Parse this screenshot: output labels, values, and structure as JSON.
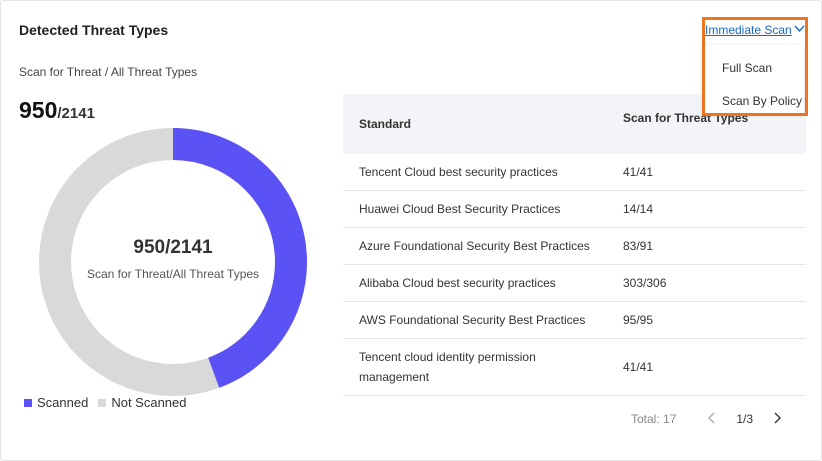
{
  "panel": {
    "title": "Detected Threat Types",
    "subtitle": "Scan for Threat / All Threat Types",
    "summary_main": "950",
    "summary_sub": "/2141"
  },
  "donut": {
    "center_value": "950/2141",
    "center_label": "Scan for Threat/All Threat Types",
    "scanned": 950,
    "total": 2141,
    "scanned_color": "#5b52f6",
    "not_scanned_color": "#d9d9d9"
  },
  "legend": {
    "scanned": "Scanned",
    "not_scanned": "Not Scanned"
  },
  "table": {
    "headers": [
      "Standard",
      "Scan for Threat Types"
    ],
    "rows": [
      {
        "standard": "Tencent Cloud best security practices",
        "value": "41/41"
      },
      {
        "standard": "Huawei Cloud Best Security Practices",
        "value": "14/14"
      },
      {
        "standard": "Azure Foundational Security Best Practices",
        "value": "83/91"
      },
      {
        "standard": "Alibaba Cloud best security practices",
        "value": "303/306"
      },
      {
        "standard": "AWS Foundational Security Best Practices",
        "value": "95/95"
      },
      {
        "standard": "Tencent cloud identity permission management",
        "value": "41/41"
      }
    ]
  },
  "pagination": {
    "total": "Total: 17",
    "page": "1/3"
  },
  "scan_menu": {
    "trigger": "Immediate Scan",
    "options": [
      "Full Scan",
      "Scan By Policy"
    ],
    "highlight_color": "#ee7420"
  }
}
